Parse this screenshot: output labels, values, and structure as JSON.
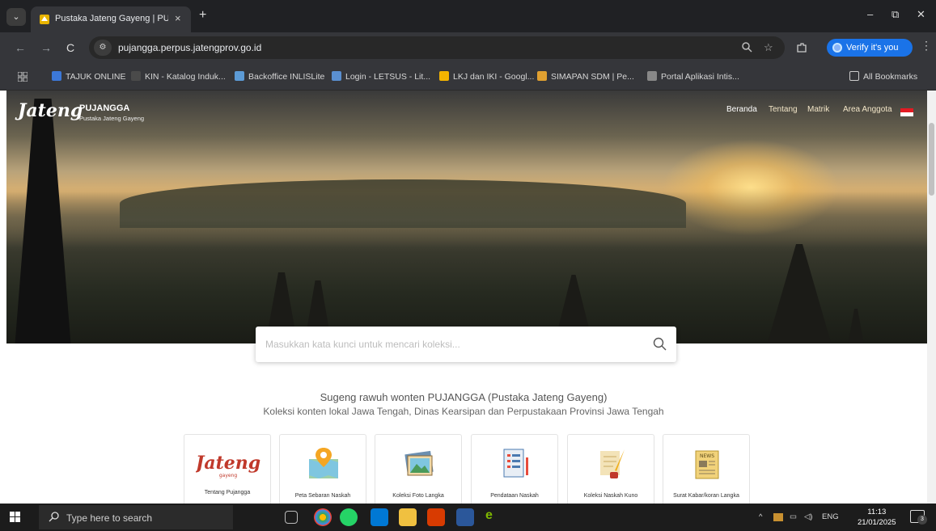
{
  "browser": {
    "tab_title": "Pustaka Jateng Gayeng | PUJAN",
    "tab_close": "×",
    "new_tab": "+",
    "url": "pujangga.perpus.jatengprov.go.id",
    "verify_label": "Verify it's you",
    "window_controls": {
      "minimize": "–",
      "restore": "⧉",
      "close": "✕"
    },
    "nav": {
      "back": "←",
      "forward": "→",
      "reload": "C"
    },
    "bookmarks": [
      {
        "label": "TAJUK ONLINE",
        "color": "#3c78d8"
      },
      {
        "label": "KIN - Katalog Induk...",
        "color": "#4a4a4a"
      },
      {
        "label": "Backoffice INLISLite",
        "color": "#5c9bd6"
      },
      {
        "label": "Login - LETSUS - Lit...",
        "color": "#5a8fd0"
      },
      {
        "label": "LKJ dan IKI - Googl...",
        "color": "#f4b400"
      },
      {
        "label": "SIMAPAN SDM | Pe...",
        "color": "#e0a030"
      },
      {
        "label": "Portal Aplikasi Intis...",
        "color": "#888888"
      }
    ],
    "all_bookmarks": "All Bookmarks"
  },
  "site": {
    "logo_script": "Jateng",
    "logo_script_sub": "gayeng",
    "logo_name": "PUJANGGA",
    "logo_sub": "Pustaka Jateng Gayeng",
    "nav": [
      "Beranda",
      "Tentang",
      "Matrik",
      "Area Anggota"
    ],
    "search_placeholder": "Masukkan kata kunci untuk mencari koleksi...",
    "welcome_line1": "Sugeng rawuh wonten PUJANGGA (Pustaka Jateng Gayeng)",
    "welcome_line2": "Koleksi konten lokal Jawa Tengah, Dinas Kearsipan dan Perpustakaan Provinsi Jawa Tengah",
    "cards": [
      {
        "label": "Tentang Pujangga",
        "icon": "jateng-logo-icon"
      },
      {
        "label": "Peta Sebaran Naskah",
        "icon": "map-pin-icon"
      },
      {
        "label": "Koleksi Foto Langka",
        "icon": "photo-icon"
      },
      {
        "label": "Pendataan Naskah",
        "icon": "document-list-icon"
      },
      {
        "label": "Koleksi Naskah Kuno",
        "icon": "quill-paper-icon"
      },
      {
        "label": "Surat Kabar/koran Langka",
        "icon": "newspaper-icon"
      }
    ]
  },
  "taskbar": {
    "search_placeholder": "Type here to search",
    "language": "ENG",
    "time": "11:13",
    "date": "21/01/2025",
    "notification_count": "3"
  }
}
